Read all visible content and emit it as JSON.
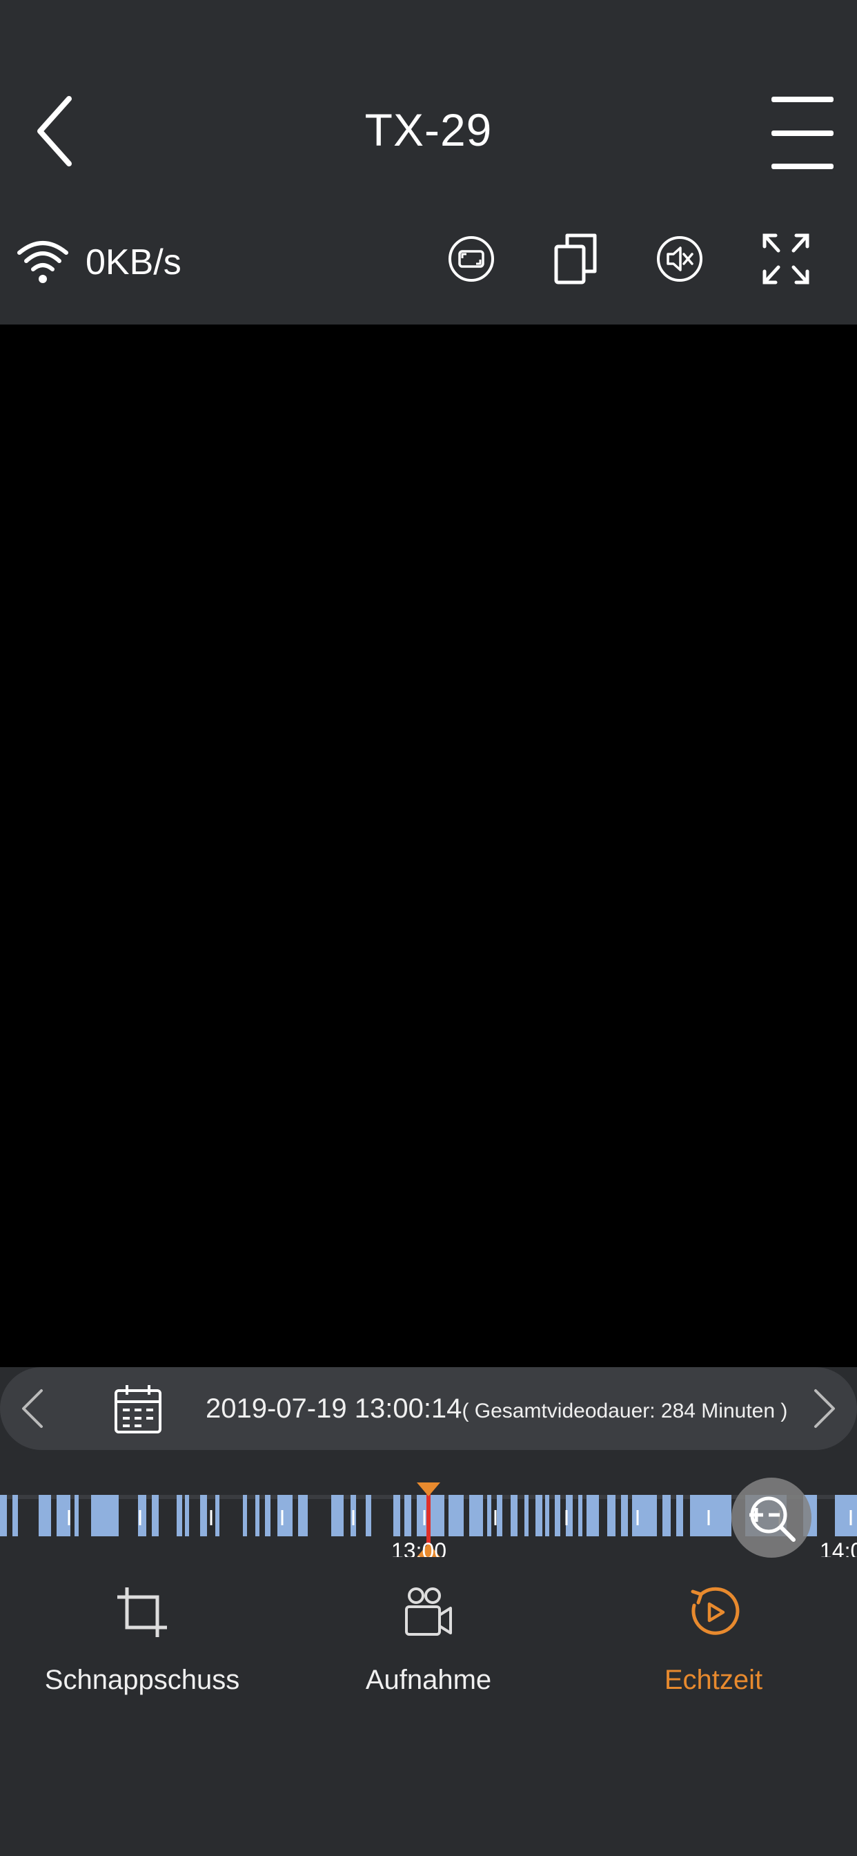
{
  "header": {
    "title": "TX-29",
    "speed": "0KB/s"
  },
  "toolbar": {
    "icons": [
      "screen-ratio-icon",
      "multi-view-icon",
      "mute-icon",
      "fullscreen-icon"
    ]
  },
  "playback": {
    "datetime": "2019-07-19 13:00:14",
    "duration": "( Gesamtvideodauer: 284 Minuten )"
  },
  "timeline": {
    "labels": [
      "13:00",
      "14:0"
    ]
  },
  "actions": [
    {
      "label": "Schnappschuss",
      "icon": "crop-icon"
    },
    {
      "label": "Aufnahme",
      "icon": "record-icon"
    },
    {
      "label": "Echtzeit",
      "icon": "live-icon"
    }
  ],
  "colors": {
    "accent": "#e88a2e",
    "timeline_fill": "#8fb0de",
    "playhead": "#e0302a",
    "background": "#2a2c2f"
  }
}
